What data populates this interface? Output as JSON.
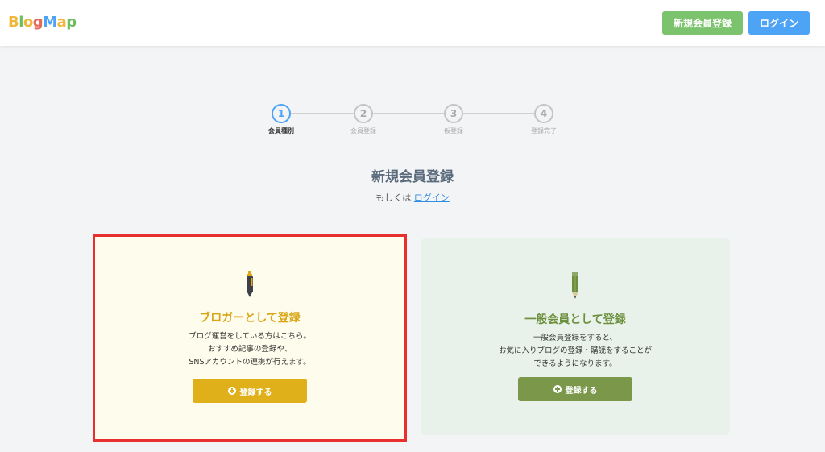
{
  "header": {
    "logo_letters": [
      "B",
      "l",
      "o",
      "g",
      "M",
      "a",
      "p"
    ],
    "logo_colors": [
      "#f0b63a",
      "#6cbf5c",
      "#f0b63a",
      "#e46a5a",
      "#4da3f5",
      "#f0b63a",
      "#6cbf5c"
    ],
    "signup_label": "新規会員登録",
    "login_label": "ログイン"
  },
  "stepper": {
    "steps": [
      {
        "number": "1",
        "label": "会員種別",
        "active": true
      },
      {
        "number": "2",
        "label": "会員登録",
        "active": false
      },
      {
        "number": "3",
        "label": "仮登録",
        "active": false
      },
      {
        "number": "4",
        "label": "登録完了",
        "active": false
      }
    ]
  },
  "main": {
    "title": "新規会員登録",
    "alt_prefix": "もしくは",
    "alt_link": "ログイン"
  },
  "cards": {
    "blogger": {
      "title": "ブロガーとして登録",
      "desc_lines": [
        "ブログ運営をしている方はこちら。",
        "おすすめ記事の登録や、",
        "SNSアカウントの連携が行えます。"
      ],
      "button_label": "登録する"
    },
    "member": {
      "title": "一般会員として登録",
      "desc_lines": [
        "一般会員登録をすると、",
        "お気に入りブログの登録・購読をすることが",
        "できるようになります。"
      ],
      "button_label": "登録する"
    }
  },
  "colors": {
    "accent_blue": "#4da3f5",
    "signup_green": "#7cc36e",
    "blogger_yellow": "#dfb01a",
    "member_green": "#7a974a",
    "highlight_red": "#e8302e"
  }
}
